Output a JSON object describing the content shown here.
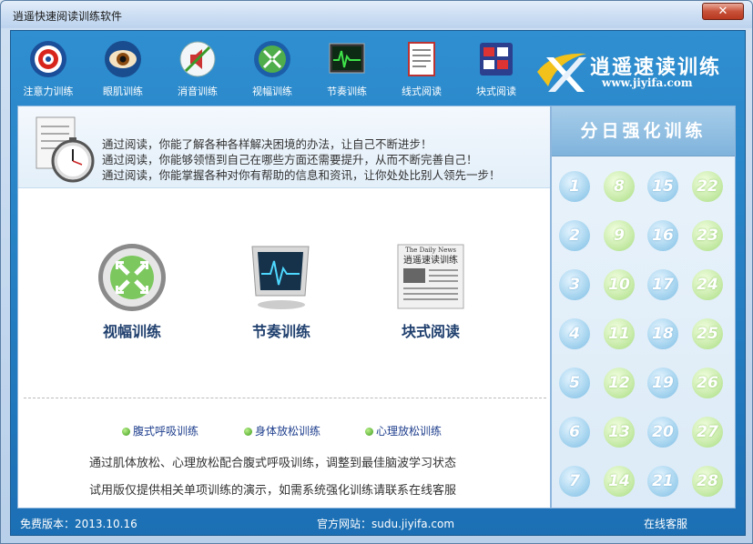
{
  "window": {
    "title": "逍遥快速阅读训练软件",
    "close_label": "✕"
  },
  "toolbar": {
    "items": [
      {
        "label": "注意力训练",
        "icon": "target-icon"
      },
      {
        "label": "眼肌训练",
        "icon": "eye-icon"
      },
      {
        "label": "消音训练",
        "icon": "mute-icon"
      },
      {
        "label": "视幅训练",
        "icon": "expand-arrows-icon"
      },
      {
        "label": "节奏训练",
        "icon": "monitor-wave-icon"
      },
      {
        "label": "线式阅读",
        "icon": "document-lines-icon"
      },
      {
        "label": "块式阅读",
        "icon": "blocks-icon"
      }
    ]
  },
  "logo": {
    "title": "逍遥速读训练",
    "url": "www.jiyifa.com"
  },
  "banner": {
    "lines": [
      "通过阅读，你能了解各种各样解决困境的办法，让自己不断进步！",
      "通过阅读，你能够领悟到自己在哪些方面还需要提升，从而不断完善自己！",
      "通过阅读，你能掌握各种对你有帮助的信息和资讯，让你处处比别人领先一步！"
    ]
  },
  "features": [
    {
      "label": "视幅训练"
    },
    {
      "label": "节奏训练"
    },
    {
      "label": "块式阅读",
      "newspaper_text": "逍遥速读训练",
      "newspaper_head": "The Daily News"
    }
  ],
  "mini_links": [
    "腹式呼吸训练",
    "身体放松训练",
    "心理放松训练"
  ],
  "desc": [
    "通过肌体放松、心理放松配合腹式呼吸训练，调整到最佳脑波学习状态",
    "试用版仅提供相关单项训练的演示，如需系统强化训练请联系在线客服"
  ],
  "side": {
    "title": "分日强化训练",
    "days": [
      "1",
      "8",
      "15",
      "22",
      "2",
      "9",
      "16",
      "23",
      "3",
      "10",
      "17",
      "24",
      "4",
      "11",
      "18",
      "25",
      "5",
      "12",
      "19",
      "26",
      "6",
      "13",
      "20",
      "27",
      "7",
      "14",
      "21",
      "28"
    ]
  },
  "status": {
    "version": "免费版本：2013.10.16",
    "site": "官方网站：sudu.jiyifa.com",
    "service": "在线客服"
  }
}
